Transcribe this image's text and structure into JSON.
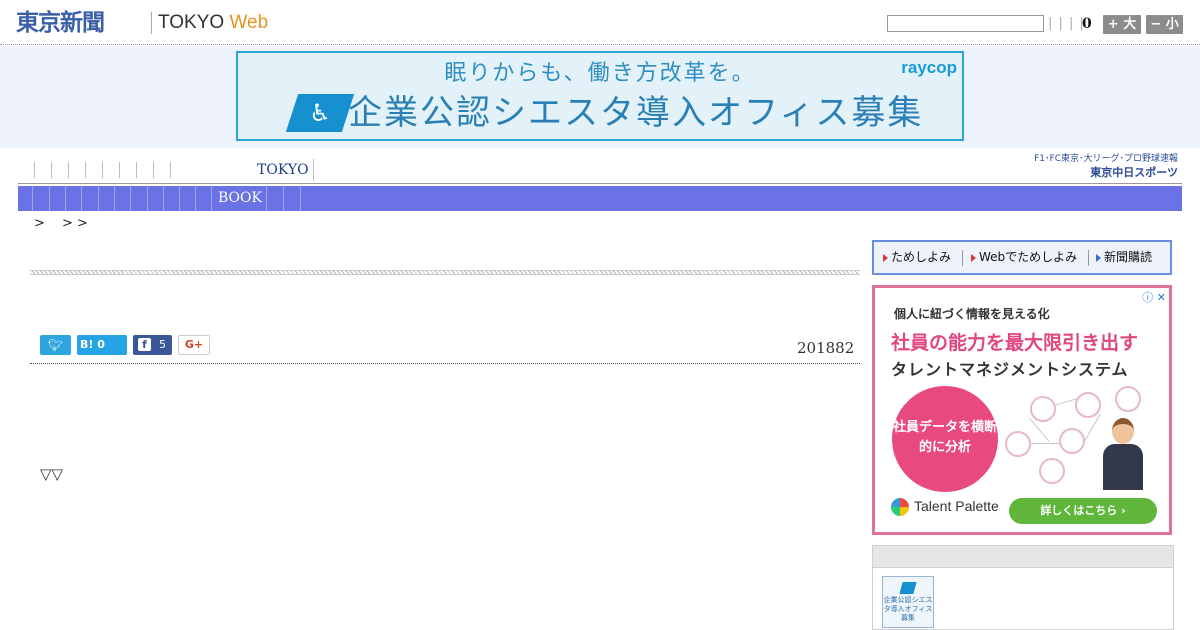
{
  "header": {
    "logo_text": "東京新聞",
    "logo_sub_prefix": "TOKYO ",
    "logo_sub_web": "Web",
    "search_value": "",
    "bars": "| | | |",
    "font_size_value": "0",
    "font_up_label": "+ 大",
    "font_down_label": "− 小"
  },
  "top_ad": {
    "line1": "眠りからも、働き方改革を。",
    "brand": "raycop",
    "line2": "企業公認シエスタ導入オフィス募集"
  },
  "nav": {
    "tokyo_label": "TOKYO",
    "book_label": "BOOK",
    "chunichi_line1": "F1･FC東京･大リーグ･プロ野球速報",
    "chunichi_line2": "東京中日スポーツ"
  },
  "breadcrumb": {
    "text": ">　 > >"
  },
  "share": {
    "hatena_label": "B! 0",
    "facebook_count": "5",
    "gplus_label": "G+"
  },
  "article": {
    "date": "201882",
    "marks": "▽▽"
  },
  "sidebar": {
    "trial_items": [
      "ためしよみ",
      "Webでためしよみ",
      "新聞購読"
    ],
    "ad": {
      "line1": "個人に紐づく情報を見える化",
      "line2": "社員の能力を最大限引き出す",
      "line3": "タレントマネジメントシステム",
      "circle_text": "社員データを横断的に分析",
      "brand": "Talent Palette",
      "cta": "詳しくはこちら ›",
      "info": "ⓘ ✕"
    },
    "thumb_text": "企業公認シエスタ導入オフィス募集"
  },
  "colors": {
    "nav_band": "#6b72e5",
    "logo_blue": "#3a5ea8",
    "web_orange": "#e8931e",
    "ad_pink": "#e2709d"
  }
}
